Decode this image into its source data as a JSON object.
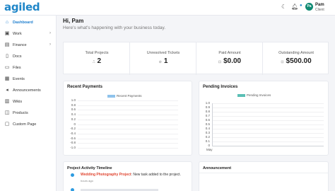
{
  "brand": {
    "logo": "agiled",
    "accent": "#1f86c8"
  },
  "topbar": {
    "icons": [
      "moon-icon",
      "bell-icon",
      "notification-dot-icon"
    ],
    "user": {
      "initials": "Pa",
      "name": "Pam",
      "role": "Client",
      "avatar_color": "#0f8a73"
    }
  },
  "sidebar": {
    "items": [
      {
        "label": "Dashboard",
        "icon": "home-icon",
        "active": true,
        "has_children": false
      },
      {
        "label": "Work",
        "icon": "briefcase-icon",
        "active": false,
        "has_children": true
      },
      {
        "label": "Finance",
        "icon": "money-icon",
        "active": false,
        "has_children": true
      },
      {
        "label": "Docs",
        "icon": "document-icon",
        "active": false,
        "has_children": false
      },
      {
        "label": "Files",
        "icon": "folder-icon",
        "active": false,
        "has_children": false
      },
      {
        "label": "Events",
        "icon": "calendar-icon",
        "active": false,
        "has_children": false
      },
      {
        "label": "Announcements",
        "icon": "megaphone-icon",
        "active": false,
        "has_children": false
      },
      {
        "label": "Wikis",
        "icon": "book-icon",
        "active": false,
        "has_children": false
      },
      {
        "label": "Products",
        "icon": "box-icon",
        "active": false,
        "has_children": false
      },
      {
        "label": "Custom Page",
        "icon": "page-icon",
        "active": false,
        "has_children": false
      }
    ]
  },
  "greeting": {
    "title": "Hi, Pam",
    "subtitle": "Here's what's happening with your business today."
  },
  "stats": [
    {
      "label": "Total Projects",
      "prefix": "⎍",
      "value": "2"
    },
    {
      "label": "Unresolved Tickets",
      "prefix": "⊘",
      "value": "1"
    },
    {
      "label": "Paid Amount",
      "prefix": "⊡",
      "value": "$0.00"
    },
    {
      "label": "Outstanding Amount",
      "prefix": "⊡",
      "value": "$500.00"
    }
  ],
  "recent_payments": {
    "title": "Recent Payments",
    "legend": "Recent Payments",
    "color": "#8fc3ec",
    "ticks": [
      "1.0",
      "0.8",
      "0.6",
      "0.4",
      "0.2",
      "0",
      "-0.2",
      "-0.4",
      "-0.6",
      "-0.8",
      "-1.0"
    ]
  },
  "pending_invoices": {
    "title": "Pending Invoices",
    "legend": "Pending Invoices",
    "color": "#5bbfb5",
    "ticks": [
      "1.0",
      "0.9",
      "0.8",
      "0.7",
      "0.6",
      "0.5",
      "0.4",
      "0.3",
      "0.2",
      "0.1",
      "0"
    ],
    "x_label": "May"
  },
  "chart_data": [
    {
      "type": "bar",
      "title": "Recent Payments",
      "series": [
        {
          "name": "Recent Payments",
          "values": []
        }
      ],
      "categories": [],
      "ylim": [
        -1.0,
        1.0
      ],
      "grid": true,
      "legend": "top"
    },
    {
      "type": "bar",
      "title": "Pending Invoices",
      "series": [
        {
          "name": "Pending Invoices",
          "values": [
            0
          ]
        }
      ],
      "categories": [
        "May"
      ],
      "ylim": [
        0,
        1.0
      ],
      "grid": true,
      "legend": "top"
    }
  ],
  "timeline": {
    "title": "Project Activity Timeline",
    "items": [
      {
        "project": "Wedding Photography Project",
        "text": ": New task added to the project.",
        "time": "hours ago"
      },
      {
        "project": "",
        "text": "",
        "time": ""
      }
    ]
  },
  "announcement": {
    "title": "Announcement"
  }
}
